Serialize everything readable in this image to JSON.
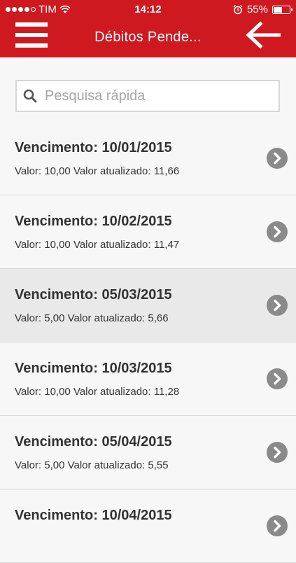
{
  "status_bar": {
    "carrier": "TIM",
    "time": "14:12",
    "battery": "55%",
    "battery_level": 0.55,
    "signal_bars_filled": 4,
    "signal_bars_total": 5
  },
  "header": {
    "title": "Débitos Pende...",
    "menu_icon": "hamburger-menu-icon",
    "back_icon": "arrow-left-icon",
    "color": "#cf1920"
  },
  "search": {
    "placeholder": "Pesquisa rápida",
    "value": ""
  },
  "items": [
    {
      "title": "Vencimento: 10/01/2015",
      "subtitle": "Valor: 10,00 Valor atualizado: 11,66"
    },
    {
      "title": "Vencimento: 10/02/2015",
      "subtitle": "Valor: 10,00 Valor atualizado: 11,47"
    },
    {
      "title": "Vencimento: 05/03/2015",
      "subtitle": "Valor: 5,00 Valor atualizado: 5,66"
    },
    {
      "title": "Vencimento: 10/03/2015",
      "subtitle": "Valor: 10,00 Valor atualizado: 11,28"
    },
    {
      "title": "Vencimento: 05/04/2015",
      "subtitle": "Valor: 5,00 Valor atualizado: 5,55"
    },
    {
      "title": "Vencimento: 10/04/2015",
      "subtitle": ""
    }
  ]
}
